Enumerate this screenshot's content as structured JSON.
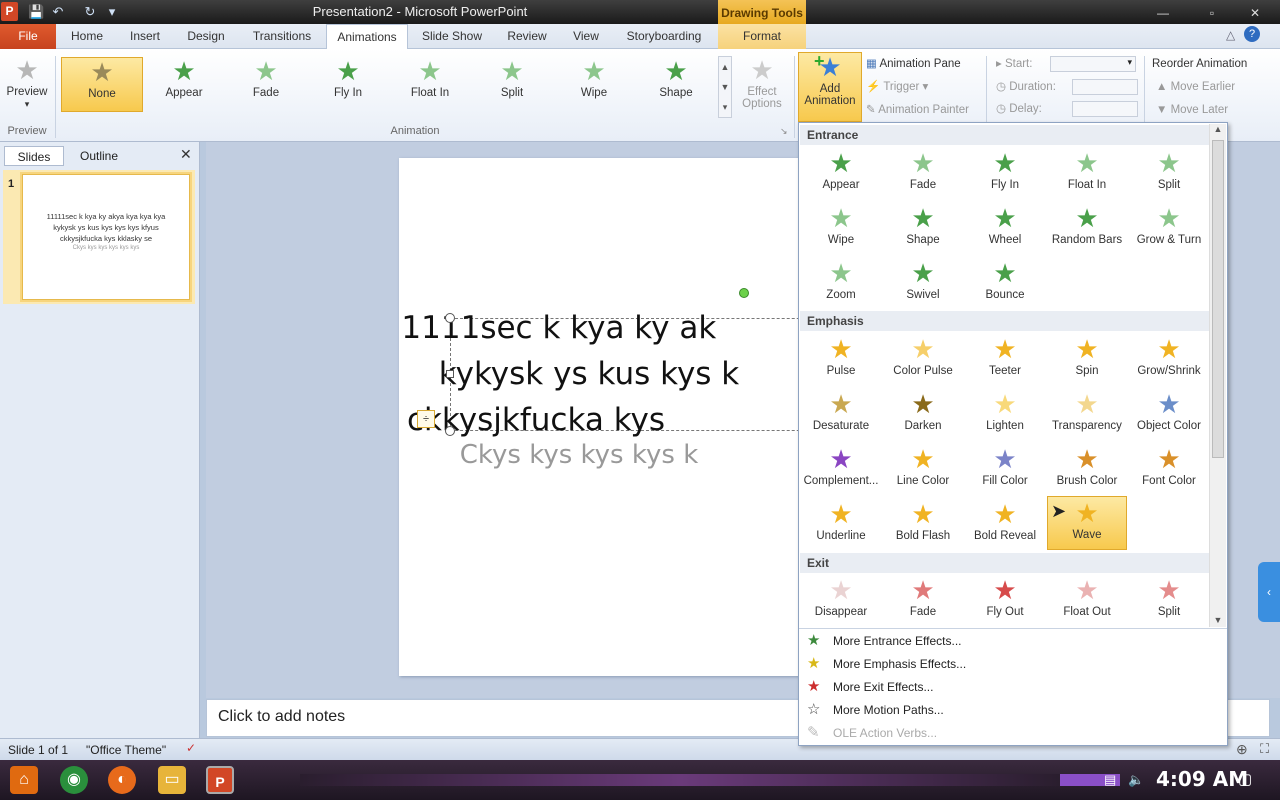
{
  "window": {
    "title": "Presentation2 - Microsoft PowerPoint",
    "app_icon": "P",
    "contextual_header": "Drawing Tools"
  },
  "tabs": [
    "File",
    "Home",
    "Insert",
    "Design",
    "Transitions",
    "Animations",
    "Slide Show",
    "Review",
    "View",
    "Storyboarding",
    "Format"
  ],
  "ribbon": {
    "preview_label": "Preview",
    "preview_group": "Preview",
    "animations": [
      "None",
      "Appear",
      "Fade",
      "Fly In",
      "Float In",
      "Split",
      "Wipe",
      "Shape"
    ],
    "effect_options_1": "Effect",
    "effect_options_2": "Options",
    "animation_group": "Animation",
    "add_animation_1": "Add",
    "add_animation_2": "Animation",
    "animation_pane": "Animation Pane",
    "trigger": "Trigger",
    "animation_painter": "Animation Painter",
    "start": "Start:",
    "duration": "Duration:",
    "delay": "Delay:",
    "reorder": "Reorder Animation",
    "move_earlier": "Move Earlier",
    "move_later": "Move Later"
  },
  "left_pane": {
    "tab_slides": "Slides",
    "tab_outline": "Outline",
    "slide_number": "1",
    "thumb_line1": "11111sec k kya ky akya kya kya kya",
    "thumb_line2": "kykysk ys kus kys kys kys kfyus",
    "thumb_line3": "ckkysjkfucka kys kklasky se",
    "thumb_line4": "Ckys kys kys kys kys kys"
  },
  "slide": {
    "line1": "11111sec k kya ky ak",
    "line2": "kykysk ys kus kys k",
    "line3": "ckkysjkfucka kys",
    "subtitle": "Ckys kys kys kys k"
  },
  "notes_placeholder": "Click to add notes",
  "status": {
    "slide_of": "Slide 1 of 1",
    "theme": "\"Office Theme\""
  },
  "gallery": {
    "entrance_header": "Entrance",
    "entrance": [
      "Appear",
      "Fade",
      "Fly In",
      "Float In",
      "Split",
      "Wipe",
      "Shape",
      "Wheel",
      "Random Bars",
      "Grow & Turn",
      "Zoom",
      "Swivel",
      "Bounce"
    ],
    "emphasis_header": "Emphasis",
    "emphasis": [
      "Pulse",
      "Color Pulse",
      "Teeter",
      "Spin",
      "Grow/Shrink",
      "Desaturate",
      "Darken",
      "Lighten",
      "Transparency",
      "Object Color",
      "Complement...",
      "Line Color",
      "Fill Color",
      "Brush Color",
      "Font Color",
      "Underline",
      "Bold Flash",
      "Bold Reveal",
      "Wave"
    ],
    "exit_header": "Exit",
    "exit": [
      "Disappear",
      "Fade",
      "Fly Out",
      "Float Out",
      "Split"
    ],
    "more_entrance": "More Entrance Effects...",
    "more_emphasis": "More Emphasis Effects...",
    "more_exit": "More Exit Effects...",
    "more_motion": "More Motion Paths...",
    "ole_verbs": "OLE Action Verbs..."
  },
  "taskbar": {
    "clock": "4:09 AM"
  }
}
